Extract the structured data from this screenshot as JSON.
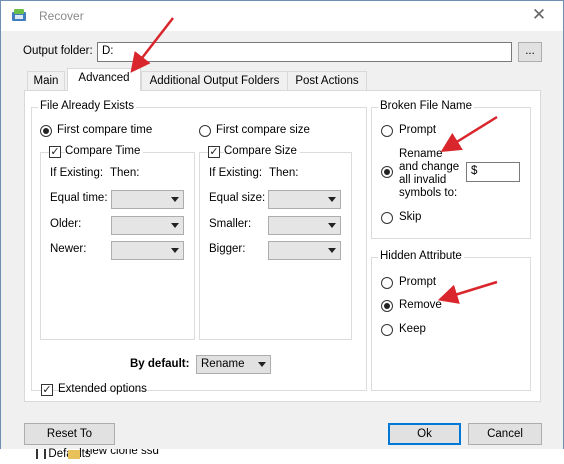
{
  "window": {
    "title": "Recover"
  },
  "output_folder": {
    "label": "Output folder:",
    "value": "D:",
    "browse_label": "..."
  },
  "tabs": [
    {
      "label": "Main"
    },
    {
      "label": "Advanced",
      "active": true
    },
    {
      "label": "Additional Output Folders"
    },
    {
      "label": "Post Actions"
    }
  ],
  "file_already_exists": {
    "title": "File Already Exists",
    "left": {
      "radio_label": "First compare time",
      "radio_checked": true,
      "check_label": "Compare Time",
      "if_existing": "If Existing:",
      "then": "Then:",
      "rows": [
        {
          "label": "Equal time:"
        },
        {
          "label": "Older:"
        },
        {
          "label": "Newer:"
        }
      ]
    },
    "right": {
      "radio_label": "First compare size",
      "radio_checked": false,
      "check_label": "Compare Size",
      "if_existing": "If Existing:",
      "then": "Then:",
      "rows": [
        {
          "label": "Equal size:"
        },
        {
          "label": "Smaller:"
        },
        {
          "label": "Bigger:"
        }
      ]
    },
    "by_default_label": "By default:",
    "by_default_value": "Rename",
    "extended_options_label": "Extended options"
  },
  "broken_file_name": {
    "title": "Broken File Name",
    "prompt_label": "Prompt",
    "rename_label_1": "Rename",
    "rename_label_2": "and change",
    "rename_label_3": "all invalid",
    "rename_label_4": "symbols to:",
    "symbol_value": "$",
    "skip_label": "Skip",
    "selected": "rename"
  },
  "hidden_attribute": {
    "title": "Hidden Attribute",
    "prompt_label": "Prompt",
    "remove_label": "Remove",
    "keep_label": "Keep",
    "selected": "remove"
  },
  "buttons": {
    "reset_label": "Reset To Defaults",
    "ok_label": "Ok",
    "cancel_label": "Cancel"
  },
  "background_text": "new clone ssd",
  "colors": {
    "annotation_arrow": "#d9262c",
    "focus_border": "#0078d7"
  }
}
